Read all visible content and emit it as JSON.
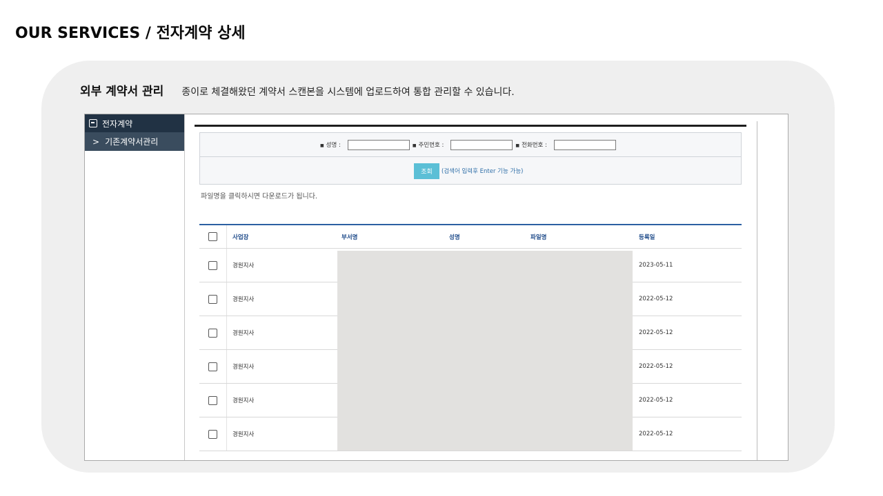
{
  "page": {
    "title": "OUR SERVICES / 전자계약 상세"
  },
  "section": {
    "title": "외부 계약서 관리",
    "description": "종이로 체결해왔던 계약서 스캔본을 시스템에 업로드하여 통합 관리할 수 있습니다."
  },
  "sidebar": {
    "top_label": "전자계약",
    "top_icon": "contract-icon",
    "sub_label": "기존계약서관리",
    "sub_icon": "chevron-right-icon"
  },
  "search": {
    "name_label": "성명 :",
    "name_value": "",
    "ssn_label": "주민번호 :",
    "ssn_value": "",
    "phone_label": "전화번호 :",
    "phone_value": "",
    "button_label": "조회",
    "hint": "(검색어 입력후 Enter 기능 가능)"
  },
  "note": "파일명을 클릭하시면 다운로드가 됩니다.",
  "table": {
    "headers": [
      "사업장",
      "부서명",
      "성명",
      "파일명",
      "등록일"
    ],
    "rows": [
      {
        "site": "경원지사",
        "date": "2023-05-11"
      },
      {
        "site": "경원지사",
        "date": "2022-05-12"
      },
      {
        "site": "경원지사",
        "date": "2022-05-12"
      },
      {
        "site": "경원지사",
        "date": "2022-05-12"
      },
      {
        "site": "경원지사",
        "date": "2022-05-12"
      },
      {
        "site": "경원지사",
        "date": "2022-05-12"
      }
    ]
  },
  "colors": {
    "sidebar_top": "#213244",
    "sidebar_sub": "#3a4c5e",
    "button": "#5bbfd6",
    "table_header_text": "#1f4b8a",
    "panel": "#efefef",
    "mask": "#e2e1df"
  }
}
